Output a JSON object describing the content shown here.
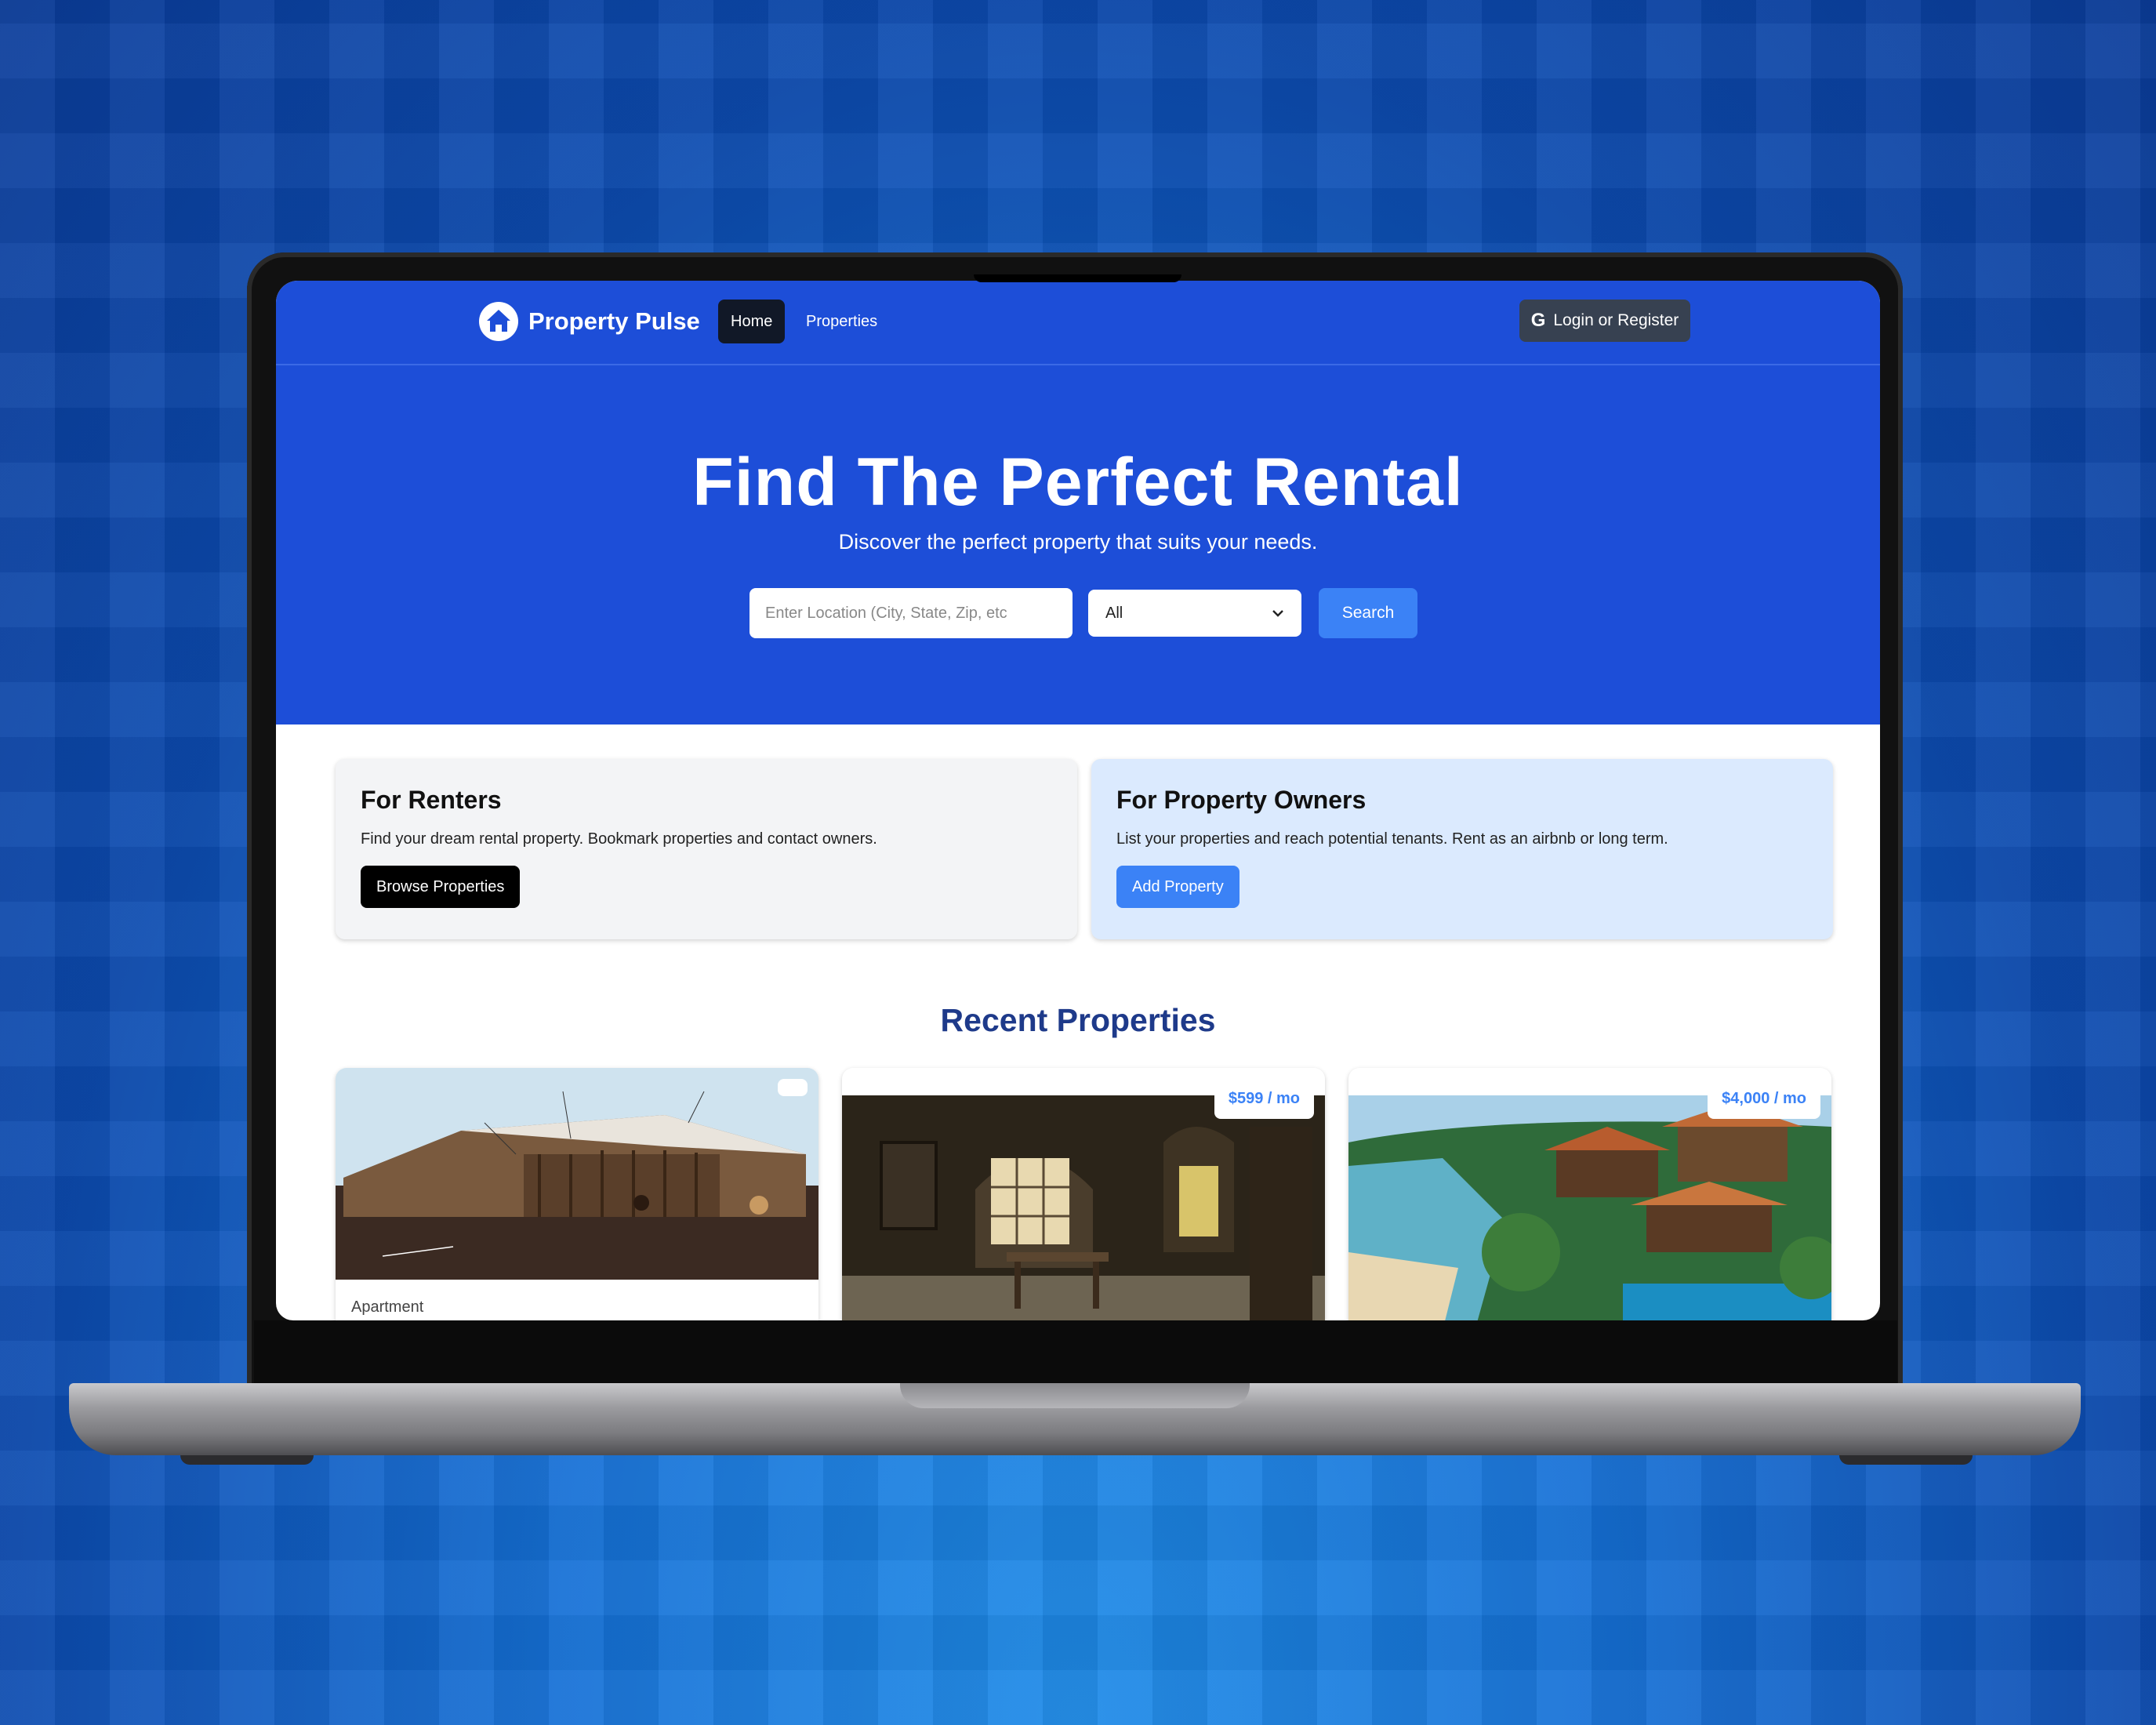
{
  "app": {
    "brand": "Property Pulse",
    "nav": {
      "home": "Home",
      "properties": "Properties",
      "login": "Login or Register"
    }
  },
  "hero": {
    "title": "Find The Perfect Rental",
    "subtitle": "Discover the perfect property that suits your needs.",
    "search": {
      "placeholder": "Enter Location (City, State, Zip, etc",
      "type_value": "All",
      "button": "Search"
    }
  },
  "info_cards": {
    "renters": {
      "title": "For Renters",
      "text": "Find your dream rental property. Bookmark properties and contact owners.",
      "button": "Browse Properties"
    },
    "owners": {
      "title": "For Property Owners",
      "text": "List your properties and reach potential tenants. Rent as an airbnb or long term.",
      "button": "Add Property"
    }
  },
  "recent": {
    "title": "Recent Properties",
    "properties": [
      {
        "type": "Apartment",
        "price": ""
      },
      {
        "type": "",
        "price": "$599 / mo"
      },
      {
        "type": "",
        "price": "$4,000 / mo"
      }
    ]
  },
  "colors": {
    "brand_blue": "#1d4ed8",
    "accent_blue": "#3b82f6",
    "heading_navy": "#1e3a8a"
  }
}
